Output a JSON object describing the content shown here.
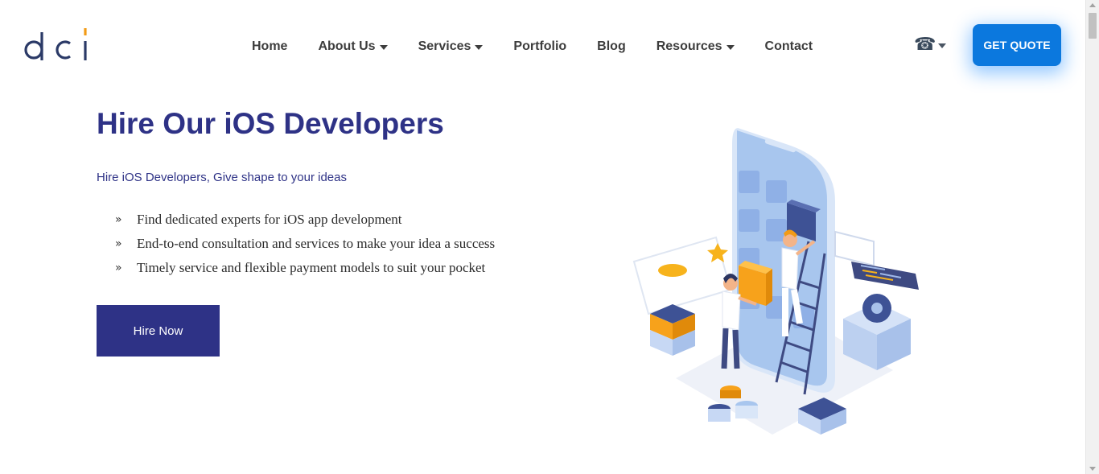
{
  "brand": {
    "logo_text": "dci"
  },
  "nav": {
    "items": [
      {
        "label": "Home",
        "dropdown": false
      },
      {
        "label": "About Us",
        "dropdown": true
      },
      {
        "label": "Services",
        "dropdown": true
      },
      {
        "label": "Portfolio",
        "dropdown": false
      },
      {
        "label": "Blog",
        "dropdown": false
      },
      {
        "label": "Resources",
        "dropdown": true
      },
      {
        "label": "Contact",
        "dropdown": false
      }
    ],
    "phone_icon": "telephone-icon",
    "cta_label": "GET QUOTE"
  },
  "hero": {
    "title": "Hire Our iOS Developers",
    "subtitle": "Hire iOS Developers, Give shape to your ideas",
    "bullet_marker": "»",
    "bullets": [
      "Find dedicated experts for iOS app development",
      "End-to-end consultation and services to make your idea a success",
      "Timely service and flexible payment models to suit your pocket"
    ],
    "button_label": "Hire Now"
  },
  "colors": {
    "brand_navy": "#2e3286",
    "cta_blue": "#0b78de",
    "logo_navy": "#2b3a67",
    "logo_orange": "#f29b16",
    "text_dark": "#3d3d3d"
  }
}
